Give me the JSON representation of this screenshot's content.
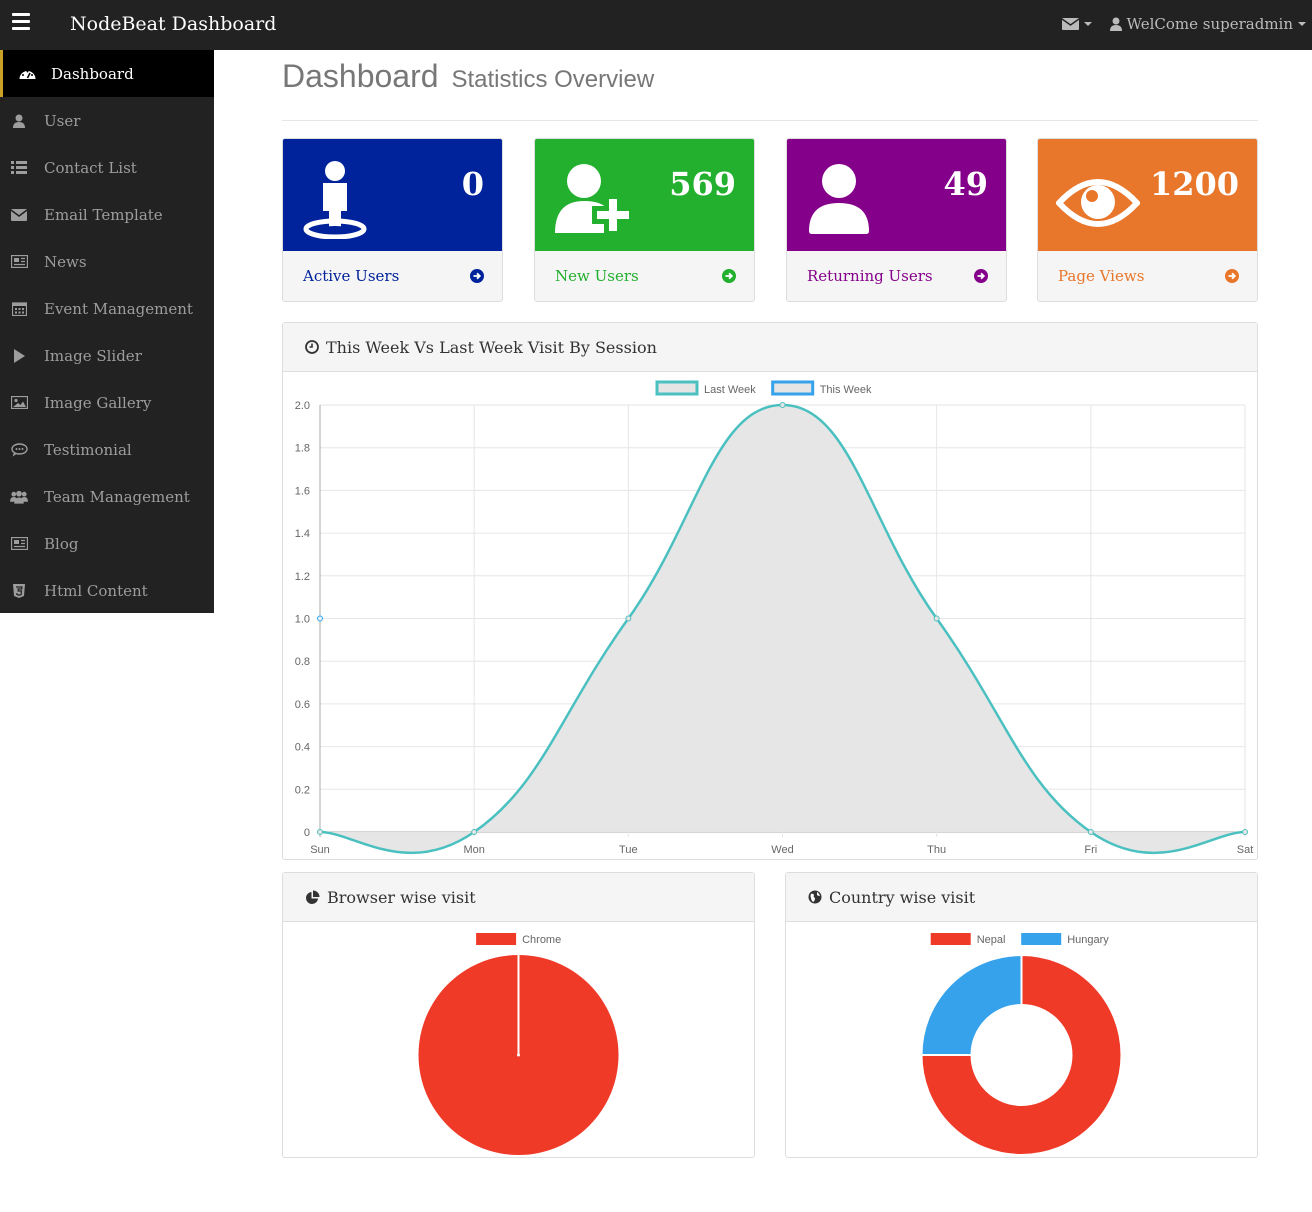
{
  "navbar": {
    "brand": "NodeBeat Dashboard",
    "welcome": "WelCome superadmin"
  },
  "sidebar": {
    "items": [
      {
        "label": "Dashboard",
        "icon": "dashboard-icon",
        "active": true
      },
      {
        "label": "User",
        "icon": "user-icon"
      },
      {
        "label": "Contact List",
        "icon": "list-icon"
      },
      {
        "label": "Email Template",
        "icon": "envelope-icon"
      },
      {
        "label": "News",
        "icon": "newspaper-icon"
      },
      {
        "label": "Event Management",
        "icon": "calendar-icon"
      },
      {
        "label": "Image Slider",
        "icon": "play-icon"
      },
      {
        "label": "Image Gallery",
        "icon": "picture-icon"
      },
      {
        "label": "Testimonial",
        "icon": "comment-icon"
      },
      {
        "label": "Team Management",
        "icon": "users-icon"
      },
      {
        "label": "Blog",
        "icon": "newspaper-icon"
      },
      {
        "label": "Html Content",
        "icon": "html5-icon"
      }
    ]
  },
  "header": {
    "title": "Dashboard",
    "subtitle": "Statistics Overview"
  },
  "stats": [
    {
      "value": "0",
      "label": "Active Users",
      "color": "#00229a",
      "icon": "person-location-icon"
    },
    {
      "value": "569",
      "label": "New Users",
      "color": "#22b02e",
      "icon": "user-add-icon"
    },
    {
      "value": "49",
      "label": "Returning Users",
      "color": "#85008a",
      "icon": "user-icon"
    },
    {
      "value": "1200",
      "label": "Page Views",
      "color": "#e8762b",
      "icon": "eye-icon"
    }
  ],
  "weekly_panel": {
    "title": "This Week Vs Last Week Visit By Session"
  },
  "browser_panel": {
    "title": "Browser wise visit"
  },
  "country_panel": {
    "title": "Country wise visit"
  },
  "chart_data": [
    {
      "type": "line",
      "categories": [
        "Sun",
        "Mon",
        "Tue",
        "Wed",
        "Thu",
        "Fri",
        "Sat"
      ],
      "series": [
        {
          "name": "Last Week",
          "values": [
            0,
            0,
            1,
            2,
            1,
            0,
            0
          ],
          "color": "#4bc0c0",
          "fill": "#e5e5e5"
        },
        {
          "name": "This Week",
          "values": [
            1,
            null,
            null,
            null,
            null,
            null,
            null
          ],
          "color": "#36a2eb"
        }
      ],
      "ylim": [
        0,
        2
      ],
      "yticks": [
        "0",
        "0.2",
        "0.4",
        "0.6",
        "0.8",
        "1.0",
        "1.2",
        "1.4",
        "1.6",
        "1.8",
        "2.0"
      ],
      "grid": true,
      "legend": "top"
    },
    {
      "type": "pie",
      "labels": [
        "Chrome"
      ],
      "values": [
        1
      ],
      "colors": [
        "#f03a28"
      ],
      "legend": "top"
    },
    {
      "type": "pie",
      "labels": [
        "Nepal",
        "Hungary"
      ],
      "values": [
        3,
        1
      ],
      "colors": [
        "#f03a28",
        "#36a2eb"
      ],
      "donut": true,
      "legend": "top"
    }
  ]
}
